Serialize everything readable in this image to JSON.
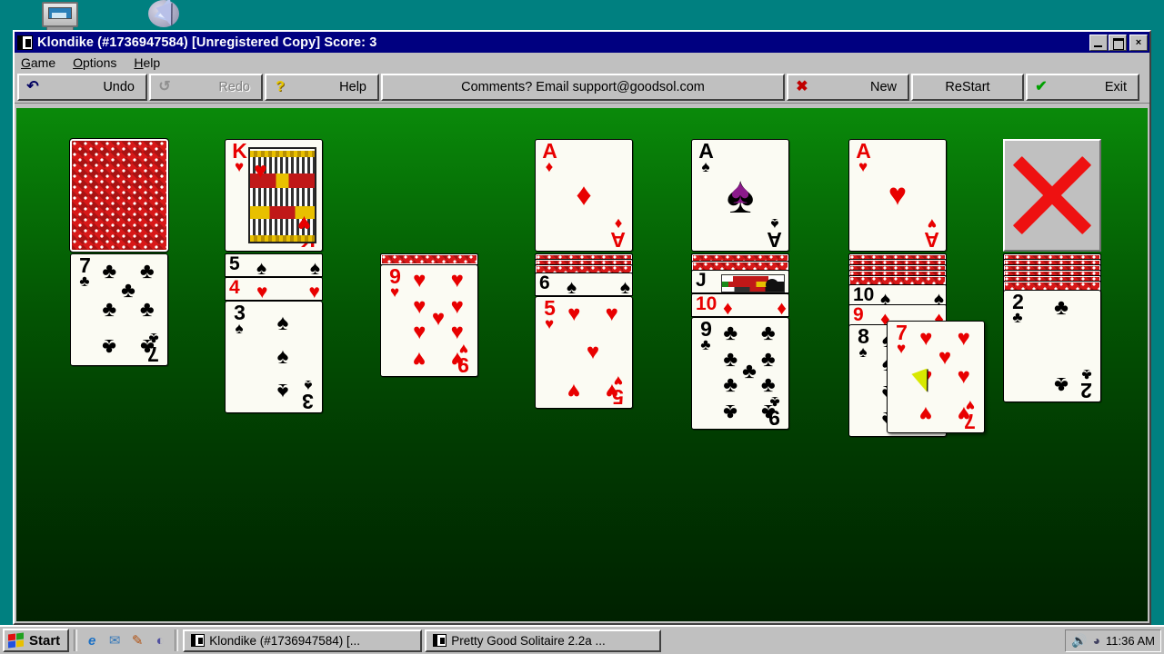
{
  "desktop": {
    "icons": [
      {
        "name": "my-computer",
        "label": ""
      },
      {
        "name": "network-neighborhood",
        "label": ""
      }
    ]
  },
  "window": {
    "title": "Klondike (#1736947584) [Unregistered Copy]   Score:  3",
    "game_name": "Klondike",
    "game_number": "#1736947584",
    "registration": "[Unregistered Copy]",
    "score_label": "Score:",
    "score_value": "3",
    "controls": {
      "minimize": "_",
      "maximize": "□",
      "close": "×"
    }
  },
  "menu": {
    "items": [
      {
        "label": "Game",
        "accel": "G"
      },
      {
        "label": "Options",
        "accel": "O"
      },
      {
        "label": "Help",
        "accel": "H"
      }
    ]
  },
  "toolbar": {
    "undo": {
      "label": "Undo",
      "icon": "undo-arrow-icon",
      "enabled": true
    },
    "redo": {
      "label": "Redo",
      "icon": "redo-arrow-icon",
      "enabled": false
    },
    "help": {
      "label": "Help",
      "icon": "question-mark-icon"
    },
    "comments": {
      "label": "Comments? Email support@goodsol.com"
    },
    "new": {
      "label": "New",
      "icon": "red-x-icon"
    },
    "restart": {
      "label": "ReStart"
    },
    "exit": {
      "label": "Exit",
      "icon": "green-check-icon"
    }
  },
  "colors": {
    "titlebar": "#000080",
    "window_face": "#c0c0c0",
    "desktop": "#008080",
    "felt_top": "#0a8a0a",
    "felt_bottom": "#002100",
    "card_red": "#e80000",
    "card_black": "#000000",
    "card_back": "#d81818",
    "empty_slot_x": "#ee1111",
    "cursor": "#d8e800"
  },
  "game": {
    "stock": {
      "face_down_count": 1,
      "label": "card-back"
    },
    "waste": {
      "rank": "K",
      "suit": "♥",
      "color": "red",
      "name": "king-of-hearts"
    },
    "foundations": [
      {
        "rank": "A",
        "suit": "♦",
        "color": "red",
        "name": "ace-of-diamonds"
      },
      {
        "rank": "A",
        "suit": "♠",
        "color": "black",
        "name": "ace-of-spades"
      },
      {
        "rank": "A",
        "suit": "♥",
        "color": "red",
        "name": "ace-of-hearts"
      },
      {
        "rank": "",
        "suit": "",
        "color": "",
        "name": "empty-foundation"
      }
    ],
    "tableau": [
      {
        "index": 1,
        "face_down": 0,
        "face_up": [
          {
            "rank": "7",
            "suit": "♣",
            "color": "black"
          }
        ]
      },
      {
        "index": 2,
        "face_down": 0,
        "face_up": [
          {
            "rank": "5",
            "suit": "♠",
            "color": "black"
          },
          {
            "rank": "4",
            "suit": "♥",
            "color": "red"
          },
          {
            "rank": "3",
            "suit": "♠",
            "color": "black"
          }
        ]
      },
      {
        "index": 3,
        "face_down": 1,
        "face_up": [
          {
            "rank": "9",
            "suit": "♥",
            "color": "red"
          }
        ]
      },
      {
        "index": 4,
        "face_down": 3,
        "face_up": [
          {
            "rank": "6",
            "suit": "♠",
            "color": "black"
          },
          {
            "rank": "5",
            "suit": "♥",
            "color": "red"
          }
        ]
      },
      {
        "index": 5,
        "face_down": 2,
        "face_up": [
          {
            "rank": "J",
            "suit": "♠",
            "color": "black"
          },
          {
            "rank": "10",
            "suit": "♦",
            "color": "red"
          },
          {
            "rank": "9",
            "suit": "♣",
            "color": "black"
          }
        ]
      },
      {
        "index": 6,
        "face_down": 5,
        "face_up": [
          {
            "rank": "10",
            "suit": "♠",
            "color": "black"
          },
          {
            "rank": "9",
            "suit": "♦",
            "color": "red"
          },
          {
            "rank": "8",
            "suit": "♠",
            "color": "black"
          }
        ]
      },
      {
        "index": 7,
        "face_down": 6,
        "face_up": [
          {
            "rank": "2",
            "suit": "♣",
            "color": "black"
          }
        ]
      }
    ],
    "dragged_card": {
      "rank": "7",
      "suit": "♥",
      "color": "red",
      "name": "seven-of-hearts"
    }
  },
  "taskbar": {
    "start_label": "Start",
    "quick_launch": [
      {
        "name": "internet-explorer-icon",
        "glyph": "e"
      },
      {
        "name": "outlook-express-icon",
        "glyph": "✉"
      },
      {
        "name": "paint-icon",
        "glyph": "✎"
      },
      {
        "name": "active-desktop-icon",
        "glyph": "◐"
      }
    ],
    "tasks": [
      {
        "name": "task-klondike",
        "label": "Klondike (#1736947584) [..."
      },
      {
        "name": "task-pretty-good-solitaire",
        "label": "Pretty Good Solitaire 2.2a ..."
      }
    ],
    "tray": {
      "volume_icon": "🔊",
      "network_icon": "◕",
      "clock": "11:36 AM"
    }
  }
}
